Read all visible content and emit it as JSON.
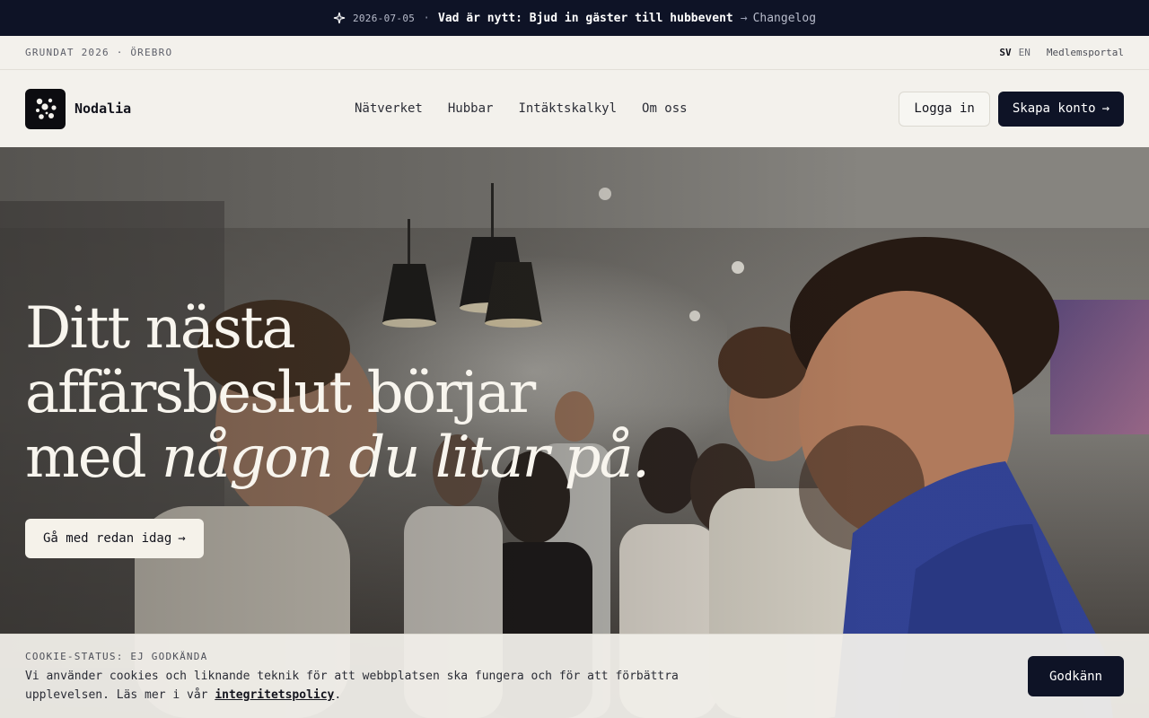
{
  "announcement": {
    "icon": "sparkle-icon",
    "date": "2026-07-05",
    "separator": "·",
    "headline": "Vad är nytt: Bjud in gäster till hubbevent",
    "arrow": "→",
    "link_label": "Changelog"
  },
  "meta_bar": {
    "founded": "GRUNDAT 2026 · ÖREBRO",
    "languages": [
      {
        "label": "SV",
        "active": true
      },
      {
        "label": "EN",
        "active": false
      }
    ],
    "portal_label": "Medlemsportal"
  },
  "header": {
    "brand_name": "Nodalia",
    "nav": [
      "Nätverket",
      "Hubbar",
      "Intäktskalkyl",
      "Om oss"
    ],
    "login_label": "Logga in",
    "signup_label": "Skapa konto",
    "signup_arrow": "→"
  },
  "hero": {
    "title_line1": "Ditt nästa",
    "title_line2": "affärsbeslut börjar",
    "title_line3_plain": "med ",
    "title_line3_emphasis": "någon du litar på.",
    "cta_label": "Gå med redan idag",
    "cta_arrow": "→"
  },
  "cookie": {
    "status": "COOKIE-STATUS: EJ GODKÄNDA",
    "text_before": "Vi använder cookies och liknande teknik för att webbplatsen ska fungera och för att förbättra upplevelsen. Läs mer i vår ",
    "policy_link": "integritetspolicy",
    "text_after": ".",
    "accept_label": "Godkänn"
  },
  "colors": {
    "dark": "#0e1326",
    "background": "#f3f1ec",
    "hero_text": "#f8f5ee"
  }
}
